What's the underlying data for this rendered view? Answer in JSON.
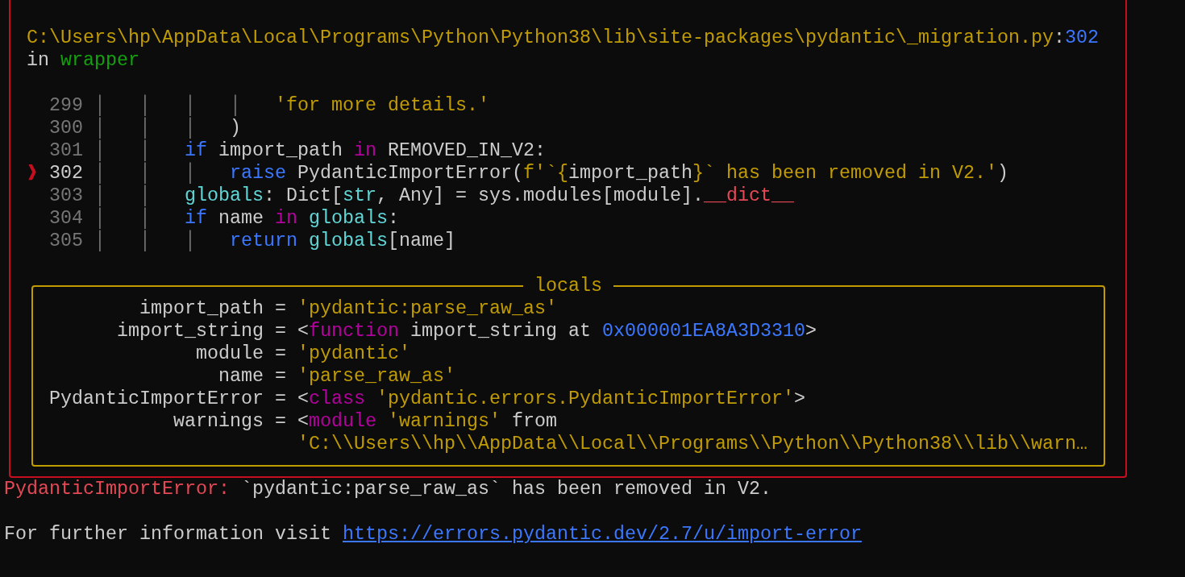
{
  "traceback": {
    "location": [
      [
        {
          "text": "C:\\Users\\hp\\AppData\\Local\\Programs\\Python\\Python38\\lib\\site-packages\\pydantic\\_migration.py",
          "kind": "string"
        },
        {
          "text": ":",
          "kind": "plain"
        },
        {
          "text": "302",
          "kind": "number"
        }
      ],
      [
        {
          "text": "in ",
          "kind": "plain"
        },
        {
          "text": "wrapper",
          "kind": "function"
        }
      ]
    ],
    "marker": "❱",
    "code_lines": [
      {
        "number": "299",
        "current": false,
        "tokens": [
          {
            "text": "│   │   │   │   ",
            "kind": "guide"
          },
          {
            "text": "'for more details.'",
            "kind": "string"
          }
        ]
      },
      {
        "number": "300",
        "current": false,
        "tokens": [
          {
            "text": "│   │   │   ",
            "kind": "guide"
          },
          {
            "text": ")",
            "kind": "plain"
          }
        ]
      },
      {
        "number": "301",
        "current": false,
        "tokens": [
          {
            "text": "│   │   ",
            "kind": "guide"
          },
          {
            "text": "if",
            "kind": "keyword"
          },
          {
            "text": " import_path ",
            "kind": "plain"
          },
          {
            "text": "in",
            "kind": "operator"
          },
          {
            "text": " REMOVED_IN_V2:",
            "kind": "plain"
          }
        ]
      },
      {
        "number": "302",
        "current": true,
        "tokens": [
          {
            "text": "│   │   │   ",
            "kind": "guide"
          },
          {
            "text": "raise",
            "kind": "keyword"
          },
          {
            "text": " PydanticImportError(",
            "kind": "plain"
          },
          {
            "text": "f'`{",
            "kind": "string"
          },
          {
            "text": "import_path",
            "kind": "plain"
          },
          {
            "text": "}` has been removed in V2.'",
            "kind": "string"
          },
          {
            "text": ")",
            "kind": "plain"
          }
        ]
      },
      {
        "number": "303",
        "current": false,
        "tokens": [
          {
            "text": "│   │   ",
            "kind": "guide"
          },
          {
            "text": "globals",
            "kind": "builtin"
          },
          {
            "text": ": Dict[",
            "kind": "plain"
          },
          {
            "text": "str",
            "kind": "builtin"
          },
          {
            "text": ", Any] = sys.modules[module].",
            "kind": "plain"
          },
          {
            "text": "__dict__",
            "kind": "dunder"
          }
        ]
      },
      {
        "number": "304",
        "current": false,
        "tokens": [
          {
            "text": "│   │   ",
            "kind": "guide"
          },
          {
            "text": "if",
            "kind": "keyword"
          },
          {
            "text": " name ",
            "kind": "plain"
          },
          {
            "text": "in ",
            "kind": "operator"
          },
          {
            "text": "globals",
            "kind": "builtin"
          },
          {
            "text": ":",
            "kind": "plain"
          }
        ]
      },
      {
        "number": "305",
        "current": false,
        "tokens": [
          {
            "text": "│   │   │   ",
            "kind": "guide"
          },
          {
            "text": "return ",
            "kind": "keyword"
          },
          {
            "text": "globals",
            "kind": "builtin"
          },
          {
            "text": "[name]",
            "kind": "plain"
          }
        ]
      }
    ],
    "locals": {
      "title": "locals",
      "items": [
        {
          "name": "import_path",
          "lines": [
            [
              {
                "text": "= ",
                "kind": "plain"
              },
              {
                "text": "'pydantic:parse_raw_as'",
                "kind": "string"
              }
            ]
          ]
        },
        {
          "name": "import_string",
          "lines": [
            [
              {
                "text": "= <",
                "kind": "plain"
              },
              {
                "text": "function",
                "kind": "operator"
              },
              {
                "text": " import_string at ",
                "kind": "plain"
              },
              {
                "text": "0x000001EA8A3D3310",
                "kind": "number"
              },
              {
                "text": ">",
                "kind": "plain"
              }
            ]
          ]
        },
        {
          "name": "module",
          "lines": [
            [
              {
                "text": "= ",
                "kind": "plain"
              },
              {
                "text": "'pydantic'",
                "kind": "string"
              }
            ]
          ]
        },
        {
          "name": "name",
          "lines": [
            [
              {
                "text": "= ",
                "kind": "plain"
              },
              {
                "text": "'parse_raw_as'",
                "kind": "string"
              }
            ]
          ]
        },
        {
          "name": "PydanticImportError",
          "lines": [
            [
              {
                "text": "= <",
                "kind": "plain"
              },
              {
                "text": "class ",
                "kind": "operator"
              },
              {
                "text": "'pydantic.errors.PydanticImportError'",
                "kind": "string"
              },
              {
                "text": ">",
                "kind": "plain"
              }
            ]
          ]
        },
        {
          "name": "warnings",
          "lines": [
            [
              {
                "text": "= <",
                "kind": "plain"
              },
              {
                "text": "module ",
                "kind": "operator"
              },
              {
                "text": "'warnings'",
                "kind": "string"
              },
              {
                "text": " from",
                "kind": "plain"
              }
            ],
            [
              {
                "text": "'C:\\\\Users\\\\hp\\\\AppData\\\\Local\\\\Programs\\\\Python\\\\Python38\\\\lib\\\\warn…",
                "kind": "string"
              }
            ]
          ]
        }
      ]
    }
  },
  "error": {
    "type": "PydanticImportError:",
    "message": " `pydantic:parse_raw_as` has been removed in V2."
  },
  "info": {
    "text": "For further information visit ",
    "link": "https://errors.pydantic.dev/2.7/u/import-error"
  }
}
